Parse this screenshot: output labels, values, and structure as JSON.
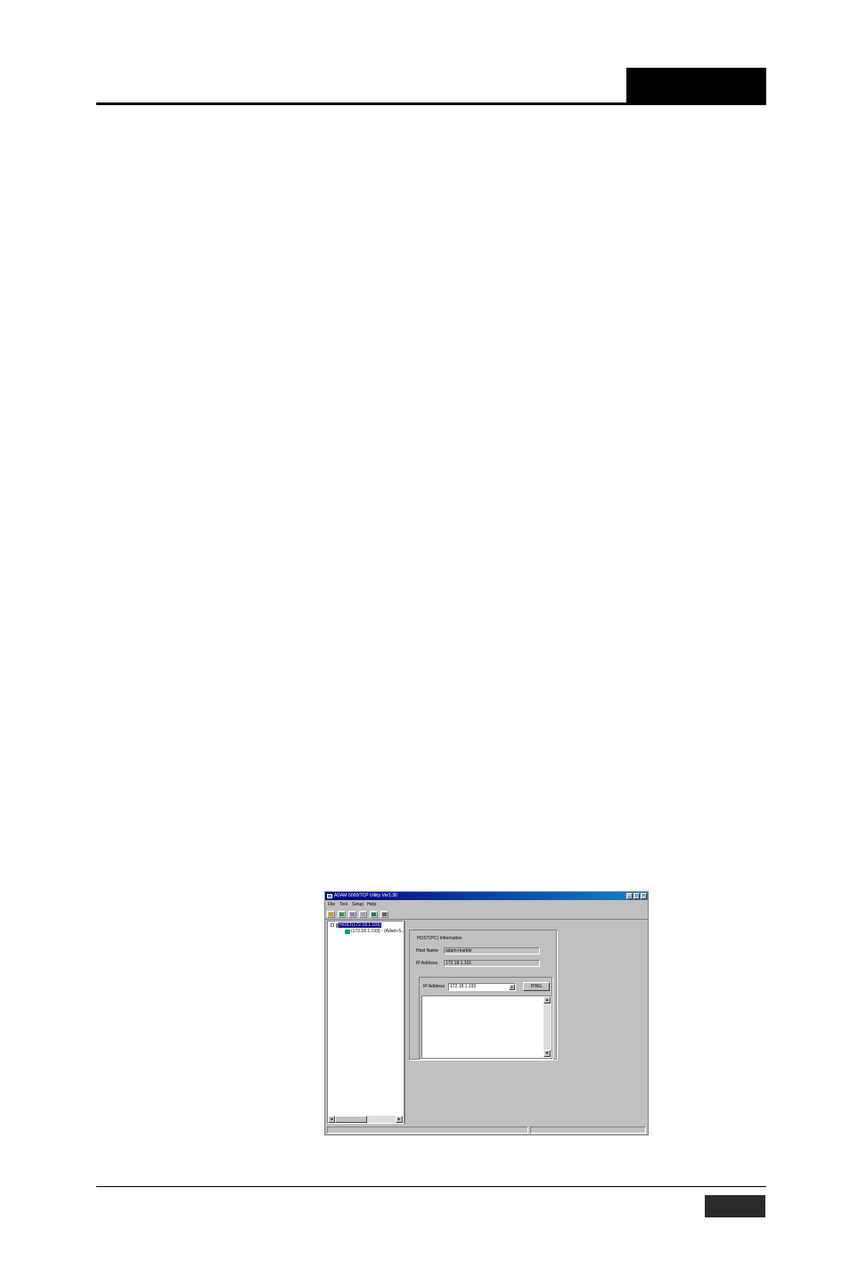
{
  "window": {
    "title": "ADAM-5000/TCP Utility Ver1.30",
    "menu": [
      "File",
      "Tool",
      "Setup",
      "Help"
    ],
    "toolbar_icons": [
      "exit-icon",
      "search-icon",
      "zoom-icon",
      "delete-icon",
      "network-icon",
      "terminal-icon"
    ]
  },
  "tree": {
    "host_node": "HOST(172.18.1.101)",
    "device_node": "(172.18.1.193) - (Adam-5..."
  },
  "info_panel": {
    "group_title": "HOST(PC) Information",
    "host_name_label": "Host Name",
    "host_name_value": "adam-marble",
    "ip_label": "IP Address",
    "ip_value": "172.18.1.101",
    "ping": {
      "ip_label": "IP Address",
      "ip_value": "172.18.1.193",
      "button": "PING"
    }
  },
  "colors": {
    "titlebar": "#000080",
    "selection": "#000080",
    "window_face": "#c0c0c0"
  }
}
